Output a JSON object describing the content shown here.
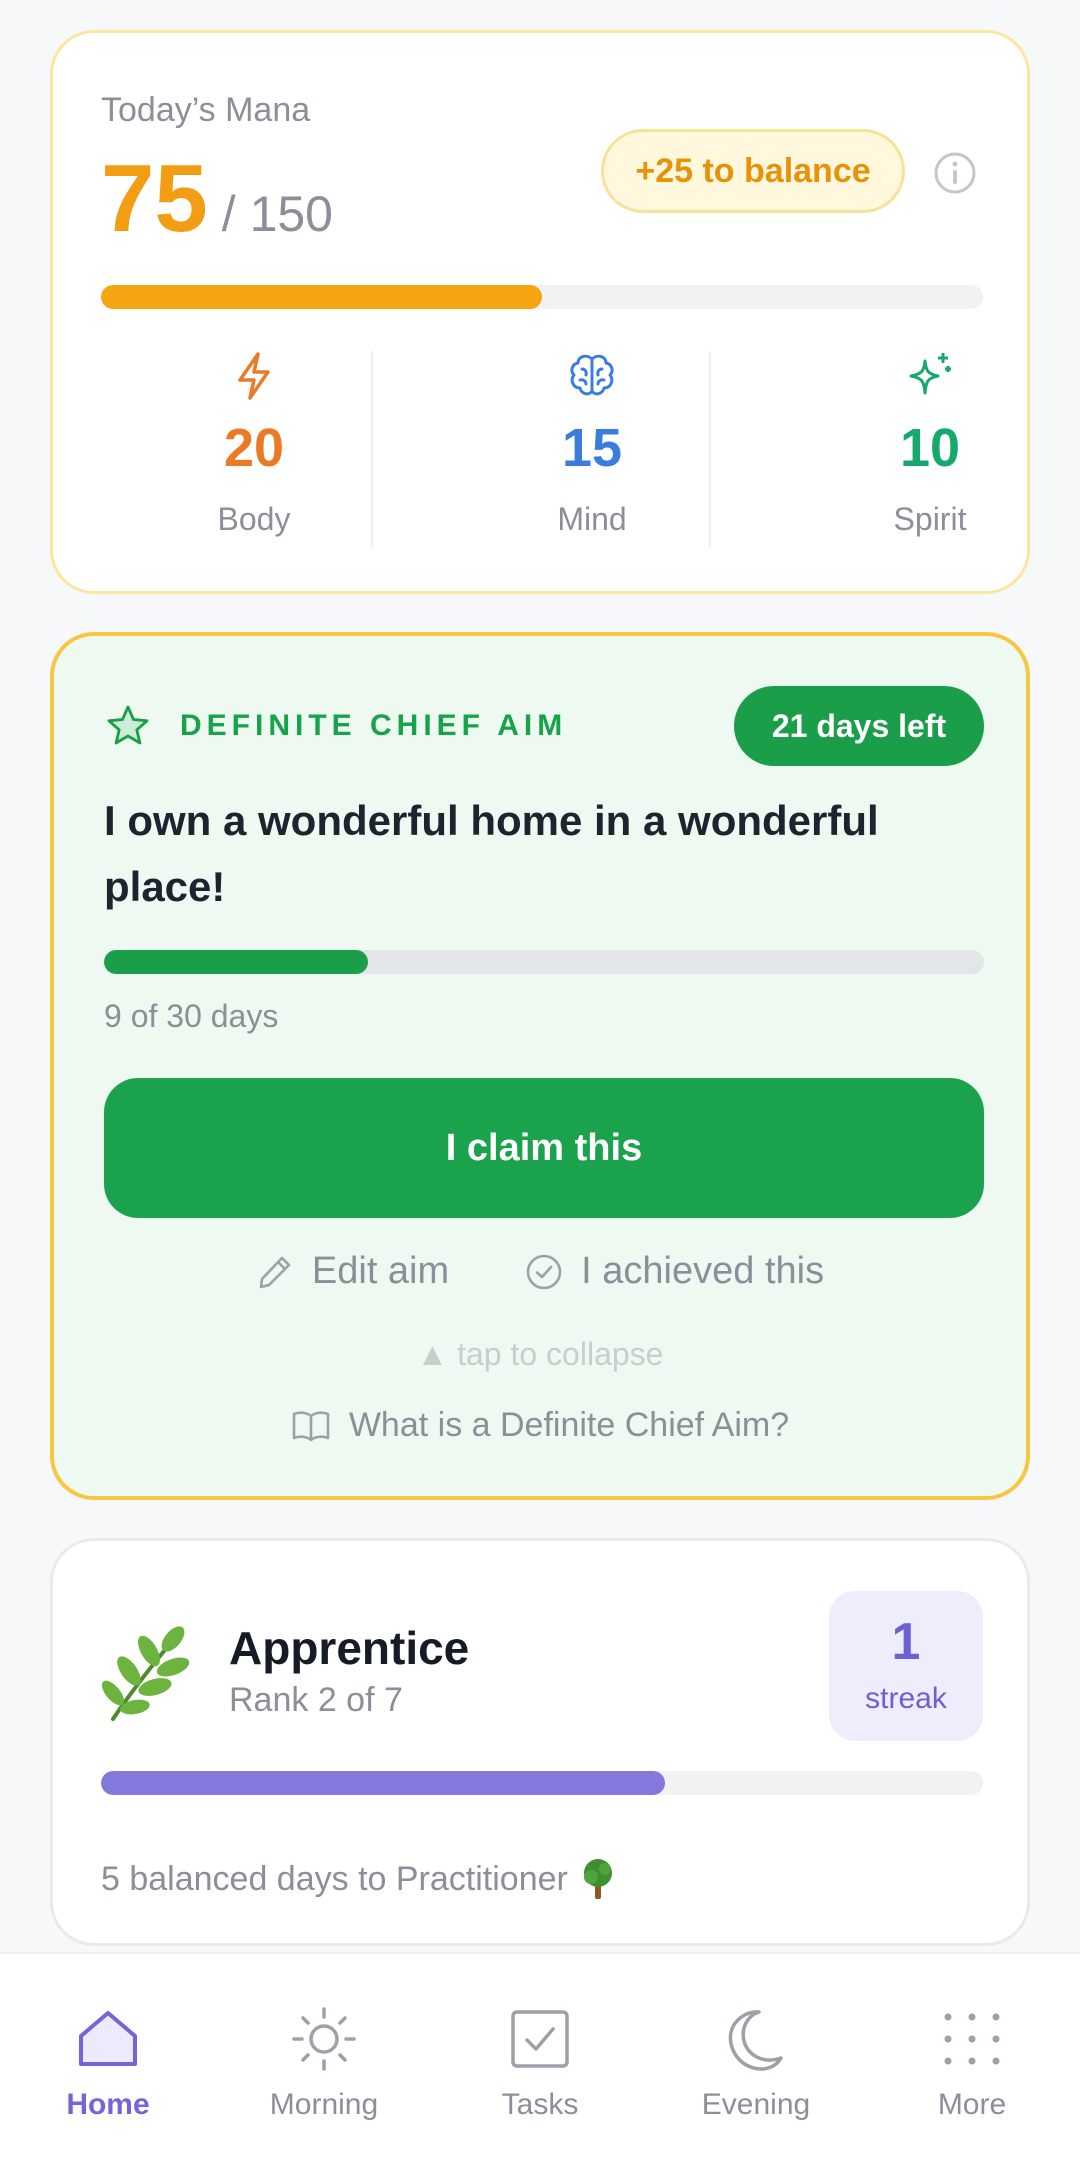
{
  "mana": {
    "label": "Today’s Mana",
    "current": "75",
    "max": "/ 150",
    "balance_pill": "+25 to balance",
    "progress_fraction": 0.5,
    "stats": [
      {
        "value": "20",
        "name": "Body",
        "icon": "lightning-icon",
        "color": "#ea7a24"
      },
      {
        "value": "15",
        "name": "Mind",
        "icon": "brain-icon",
        "color": "#3b7ddd"
      },
      {
        "value": "10",
        "name": "Spirit",
        "icon": "sparkle-icon",
        "color": "#17a86b"
      }
    ]
  },
  "aim": {
    "section_title": "DEFINITE CHIEF AIM",
    "days_left": "21 days left",
    "text": "I own a wonderful home in a wonderful place!",
    "progress_fraction": 0.3,
    "progress_text": "9 of 30 days",
    "claim_button": "I claim this",
    "edit_label": "Edit aim",
    "achieved_label": "I achieved this",
    "collapse_hint": "▲ tap to collapse",
    "what_is_link": "What is a Definite Chief Aim?"
  },
  "rank": {
    "name": "Apprentice",
    "subtitle": "Rank 2 of 7",
    "streak_value": "1",
    "streak_label": "streak",
    "progress_fraction": 0.64,
    "note": "5 balanced days to Practitioner"
  },
  "nav": {
    "items": [
      {
        "label": "Home",
        "icon": "home-icon",
        "active": true
      },
      {
        "label": "Morning",
        "icon": "sun-icon",
        "active": false
      },
      {
        "label": "Tasks",
        "icon": "checkbox-icon",
        "active": false
      },
      {
        "label": "Evening",
        "icon": "moon-icon",
        "active": false
      },
      {
        "label": "More",
        "icon": "grid-dots-icon",
        "active": false
      }
    ]
  },
  "colors": {
    "mana_orange": "#f4a511",
    "aim_green": "#1a9e4a",
    "rank_purple": "#8478dc",
    "nav_active": "#7565d9"
  }
}
